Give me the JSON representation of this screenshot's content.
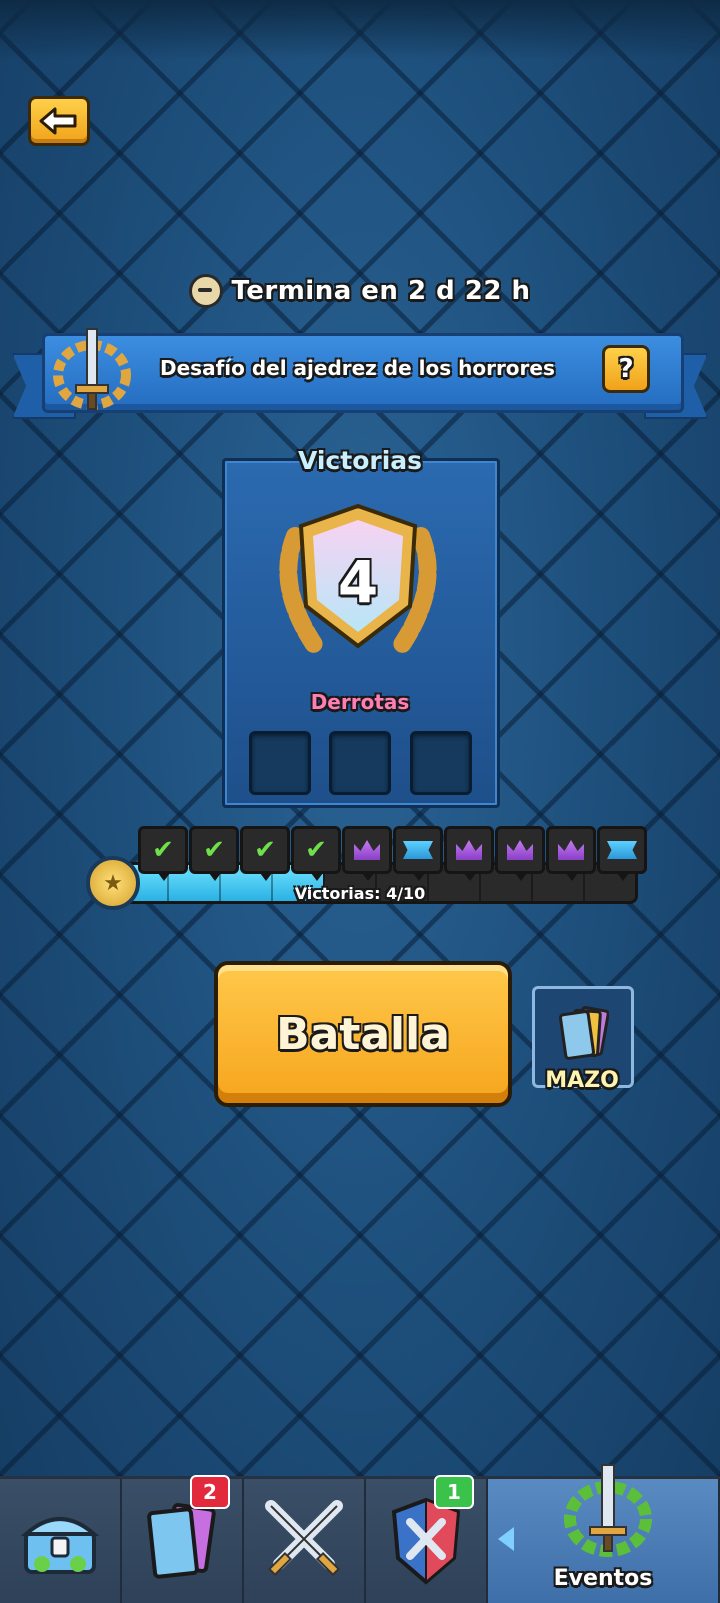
{
  "header": {
    "timer_text": "Termina en 2 d 22 h"
  },
  "challenge": {
    "title": "Desafío del ajedrez de los horrores",
    "help_label": "?"
  },
  "victories_panel": {
    "title": "Victorias",
    "wins_count": "4",
    "losses_label": "Derrotas",
    "losses_used": 0,
    "losses_total": 3
  },
  "progress": {
    "label": "Victorias: 4/10",
    "current": 4,
    "total": 10,
    "milestones": [
      {
        "type": "check-icon",
        "done": true
      },
      {
        "type": "check-icon",
        "done": true
      },
      {
        "type": "check-icon",
        "done": true
      },
      {
        "type": "check-icon",
        "done": true
      },
      {
        "type": "crown-icon",
        "done": false
      },
      {
        "type": "flag-icon",
        "done": false
      },
      {
        "type": "crown-icon",
        "done": false
      },
      {
        "type": "crown-icon",
        "done": false
      },
      {
        "type": "crown-icon",
        "done": false
      },
      {
        "type": "flag-icon",
        "done": false
      }
    ]
  },
  "actions": {
    "battle_label": "Batalla",
    "deck_label": "MAZO"
  },
  "nav": {
    "items": [
      {
        "name": "shop",
        "icon": "chest-icon"
      },
      {
        "name": "cards",
        "icon": "cards-icon",
        "badge": "2"
      },
      {
        "name": "battle",
        "icon": "crossed-swords-icon"
      },
      {
        "name": "clan",
        "icon": "clan-shield-icon",
        "badge": "1"
      },
      {
        "name": "events",
        "icon": "events-wreath-icon",
        "label": "Eventos"
      }
    ]
  },
  "colors": {
    "background": "#1d4f7c",
    "accent_gold": "#f6a51d",
    "banner_blue": "#2f7fd4",
    "loss_pink": "#ff7fb4",
    "progress_cyan": "#4fcdf2"
  }
}
